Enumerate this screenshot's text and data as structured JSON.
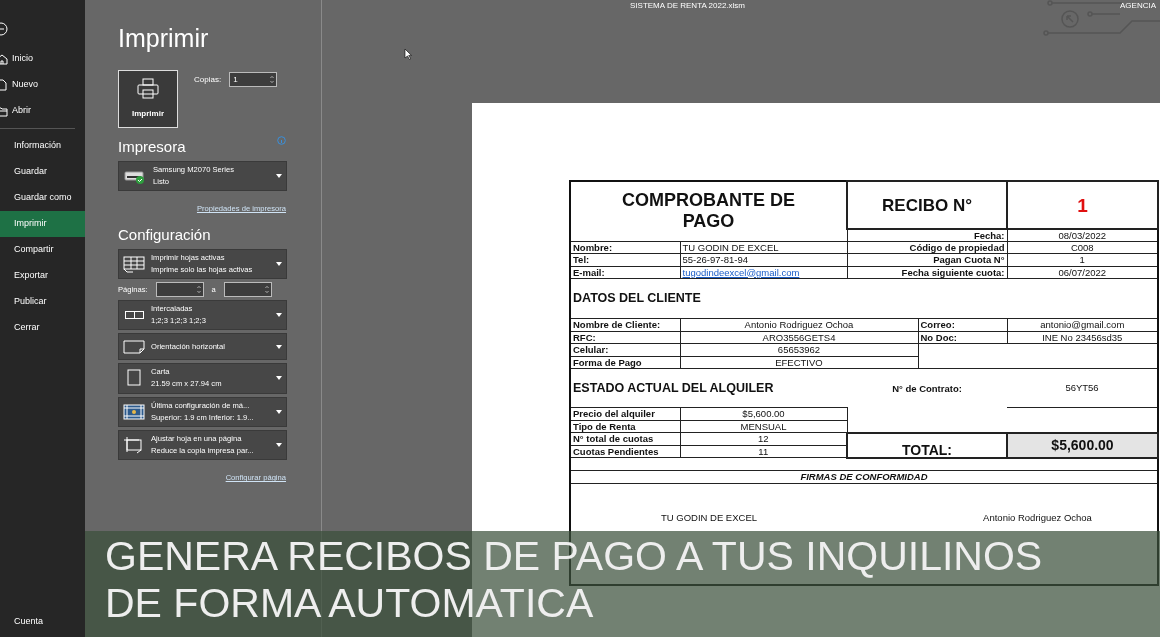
{
  "window": {
    "title": "SISTEMA DE RENTA 2022.xlsm",
    "brand": "AGENCIA"
  },
  "nav": {
    "items": [
      {
        "label": "Inicio",
        "kind": "home",
        "selected": false
      },
      {
        "label": "Nuevo",
        "kind": "document",
        "selected": false
      },
      {
        "label": "Abrir",
        "kind": "folder",
        "selected": false
      },
      {
        "label": "Información",
        "selected": false
      },
      {
        "label": "Guardar",
        "selected": false
      },
      {
        "label": "Guardar como",
        "selected": false
      },
      {
        "label": "Imprimir",
        "selected": true
      },
      {
        "label": "Compartir",
        "selected": false
      },
      {
        "label": "Exportar",
        "selected": false
      },
      {
        "label": "Publicar",
        "selected": false
      },
      {
        "label": "Cerrar",
        "selected": false
      }
    ],
    "footer": "Cuenta"
  },
  "print_panel": {
    "heading": "Imprimir",
    "print_button": "Imprimir",
    "copies": {
      "label": "Copias:",
      "value": "1"
    },
    "printer": {
      "heading": "Impresora",
      "name": "Samsung M2070 Series",
      "status": "Listo",
      "properties_link": "Propiedades de impresora"
    },
    "settings": {
      "heading": "Configuración",
      "options": [
        {
          "kind": "sheets",
          "line1": "Imprimir hojas activas",
          "line2": "Imprime solo las hojas activas"
        },
        {
          "kind": "pages",
          "label": "Páginas:",
          "separator": "a"
        },
        {
          "kind": "collate",
          "line1": "Intercaladas",
          "line2": "1;2;3   1;2;3   1;2;3"
        },
        {
          "kind": "orientation",
          "line1": "Orientación horizontal"
        },
        {
          "kind": "paper",
          "line1": "Carta",
          "line2": "21.59 cm x 27.94 cm"
        },
        {
          "kind": "margins",
          "line1": "Última configuración de má...",
          "line2": "Superior: 1.9 cm Inferior: 1.9..."
        },
        {
          "kind": "scaling",
          "line1": "Ajustar hoja en una página",
          "line2": "Reduce la copia impresa par..."
        }
      ],
      "page_setup_link": "Configurar página"
    }
  },
  "receipt": {
    "title": "COMPROBANTE  DE PAGO",
    "receipt_label": "RECIBO N°",
    "receipt_number": "1",
    "date_label": "Fecha:",
    "date": "08/03/2022",
    "owner_rows": [
      {
        "label": "Nombre:",
        "value": "TU GODIN DE EXCEL",
        "kind": "text",
        "label_2": "Código de propiedad",
        "value_2": "C008"
      },
      {
        "label": "Tel:",
        "value": "55-26-97-81-94",
        "kind": "text",
        "label_2": "Pagan Cuota N°",
        "value_2": "1"
      },
      {
        "label": "E-mail:",
        "value": "tugodindeexcel@gmail.com",
        "kind": "link",
        "label_2": "Fecha siguiente cuota:",
        "value_2": "06/07/2022"
      }
    ],
    "client": {
      "heading": "DATOS DEL CLIENTE",
      "rows": [
        {
          "label": "Nombre de Cliente:",
          "value": "Antonio Rodriguez Ochoa",
          "label_2": "Correo:",
          "value_2": "antonio@gmail.com"
        },
        {
          "label": "RFC:",
          "value": "ARO3556GETS4",
          "label_2": "No Doc:",
          "value_2": "INE No 23456sd35"
        },
        {
          "label": "Celular:",
          "value": "65653962"
        },
        {
          "label": "Forma de Pago",
          "value": "EFECTIVO"
        }
      ]
    },
    "rental": {
      "heading": "ESTADO ACTUAL DEL ALQUILER",
      "contract_label": "N° de Contrato:",
      "contract": "56YT56",
      "rows": [
        {
          "label": "Precio del alquiler",
          "value": "$5,600.00"
        },
        {
          "label": "Tipo de Renta",
          "value": "MENSUAL"
        },
        {
          "label": "N° total de cuotas",
          "value": "12"
        },
        {
          "label": "Cuotas Pendientes",
          "value": "11"
        }
      ],
      "total_label": "TOTAL:",
      "total": "$5,600.00"
    },
    "signatures": {
      "heading": "FIRMAS DE CONFORMIDAD",
      "names": [
        "TU GODIN DE EXCEL",
        "Antonio Rodriguez Ochoa"
      ]
    }
  },
  "caption": {
    "lines": [
      "GENERA RECIBOS DE PAGO A TUS INQUILINOS",
      "DE FORMA AUTOMATICA"
    ]
  }
}
